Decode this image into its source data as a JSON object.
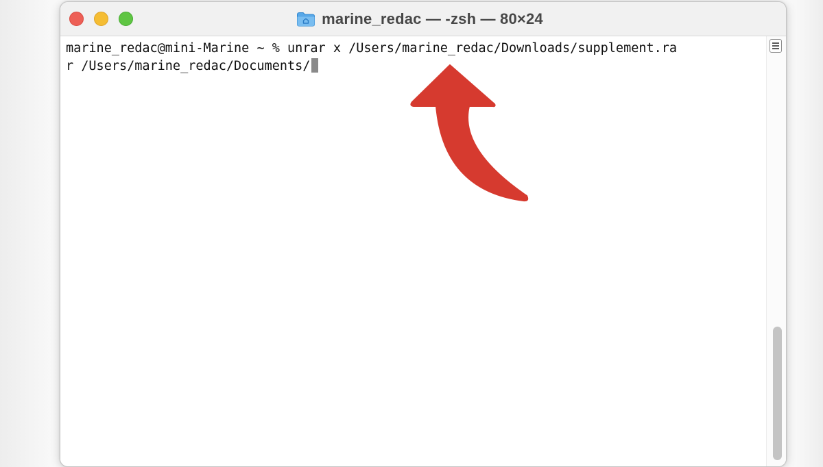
{
  "window": {
    "title": "marine_redac — -zsh — 80×24",
    "title_icon": "folder-icon",
    "traffic_lights": {
      "close_color": "#ed5f56",
      "minimize_color": "#f5bd33",
      "zoom_color": "#5fc543"
    }
  },
  "terminal": {
    "lines": [
      "marine_redac@mini-Marine ~ % unrar x /Users/marine_redac/Downloads/supplement.ra",
      "r /Users/marine_redac/Documents/"
    ],
    "cursor": "block"
  },
  "annotation": {
    "type": "curved-arrow",
    "color": "#d63a2f",
    "points_to": "command line"
  }
}
